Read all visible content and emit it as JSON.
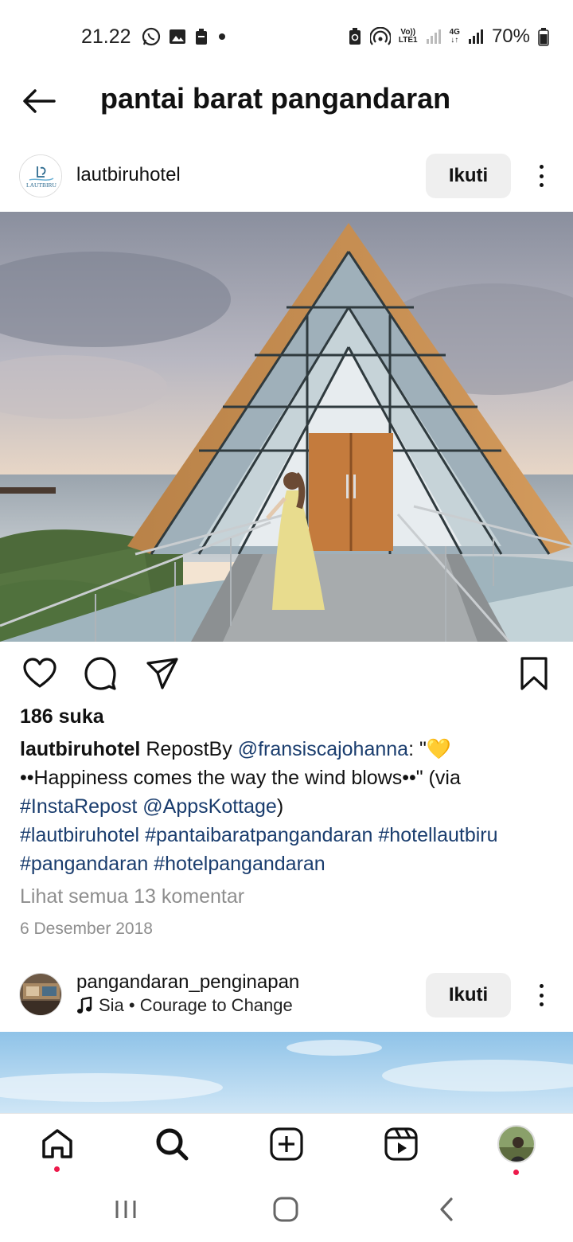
{
  "status_bar": {
    "time": "21.22",
    "battery": "70%",
    "volte": "Vo))",
    "lte": "LTE1",
    "net": "4G"
  },
  "header": {
    "title": "pantai barat pangandaran"
  },
  "post1": {
    "username": "lautbiruhotel",
    "avatar_logo": "LAUTBIRU",
    "follow_label": "Ikuti",
    "likes": "186 suka",
    "caption_user": "lautbiruhotel",
    "caption_parts": [
      {
        "text": "RepostBy ",
        "type": "text"
      },
      {
        "text": "@fransiscajohanna",
        "type": "tag"
      },
      {
        "text": ": \"💛",
        "type": "text"
      },
      {
        "text": "••Happiness comes the way the wind blows••\" (via ",
        "type": "text"
      },
      {
        "text": "#InstaRepost",
        "type": "tag"
      },
      {
        "text": " ",
        "type": "text"
      },
      {
        "text": "@AppsKottage",
        "type": "tag"
      },
      {
        "text": ")",
        "type": "text"
      }
    ],
    "hashtags": [
      "#lautbiruhotel",
      "#pantaibaratpangandaran",
      "#hotellautbiru",
      "#pangandaran",
      "#hotelpangandaran"
    ],
    "comments_link": "Lihat semua 13 komentar",
    "date": "6 Desember 2018"
  },
  "post2": {
    "username": "pangandaran_penginapan",
    "music": "Sia • Courage to Change",
    "follow_label": "Ikuti"
  },
  "colors": {
    "link": "#1a3d6e",
    "muted": "#8e8e8e",
    "button_bg": "#efefef",
    "notification_dot": "#ed1a4b"
  },
  "icons": [
    "back-arrow-icon",
    "heart-icon",
    "comment-icon",
    "share-icon",
    "bookmark-icon",
    "home-icon",
    "search-icon",
    "create-icon",
    "reels-icon",
    "more-icon",
    "music-note-icon"
  ]
}
